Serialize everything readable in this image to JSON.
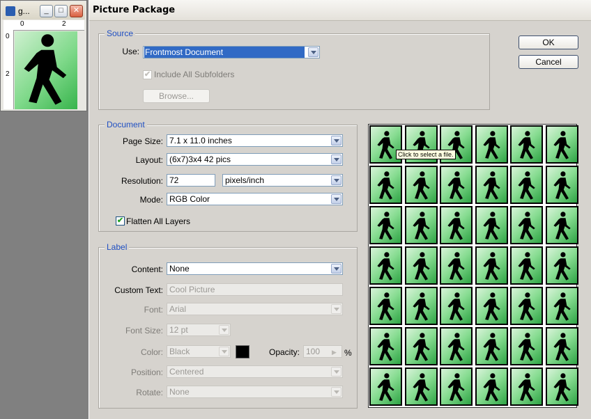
{
  "doc_window": {
    "title": "g...",
    "ruler_top_ticks": [
      "0",
      "2"
    ],
    "ruler_left_ticks": [
      "0",
      "2"
    ]
  },
  "dialog": {
    "title": "Picture Package",
    "ok_label": "OK",
    "cancel_label": "Cancel"
  },
  "source": {
    "legend": "Source",
    "use_label": "Use:",
    "use_value": "Frontmost Document",
    "include_subfolders_label": "Include All Subfolders",
    "include_subfolders_checked": true,
    "browse_label": "Browse..."
  },
  "document": {
    "legend": "Document",
    "page_size_label": "Page Size:",
    "page_size_value": "7.1 x 11.0 inches",
    "layout_label": "Layout:",
    "layout_value": "(6x7)3x4 42 pics",
    "resolution_label": "Resolution:",
    "resolution_value": "72",
    "resolution_unit": "pixels/inch",
    "mode_label": "Mode:",
    "mode_value": "RGB Color",
    "flatten_label": "Flatten All Layers",
    "flatten_checked": true
  },
  "label": {
    "legend": "Label",
    "content_label": "Content:",
    "content_value": "None",
    "custom_text_label": "Custom Text:",
    "custom_text_value": "Cool Picture",
    "font_label": "Font:",
    "font_value": "Arial",
    "font_size_label": "Font Size:",
    "font_size_value": "12 pt",
    "color_label": "Color:",
    "color_value": "Black",
    "swatch_color": "#000000",
    "opacity_label": "Opacity:",
    "opacity_value": "100",
    "opacity_unit": "%",
    "position_label": "Position:",
    "position_value": "Centered",
    "rotate_label": "Rotate:",
    "rotate_value": "None"
  },
  "preview": {
    "columns": 6,
    "rows": 7,
    "tooltip": "Click to select a file."
  },
  "colors": {
    "legend_blue": "#1f4fc2",
    "selection_blue": "#316ac5",
    "tile_green": "#5ccc6e"
  }
}
